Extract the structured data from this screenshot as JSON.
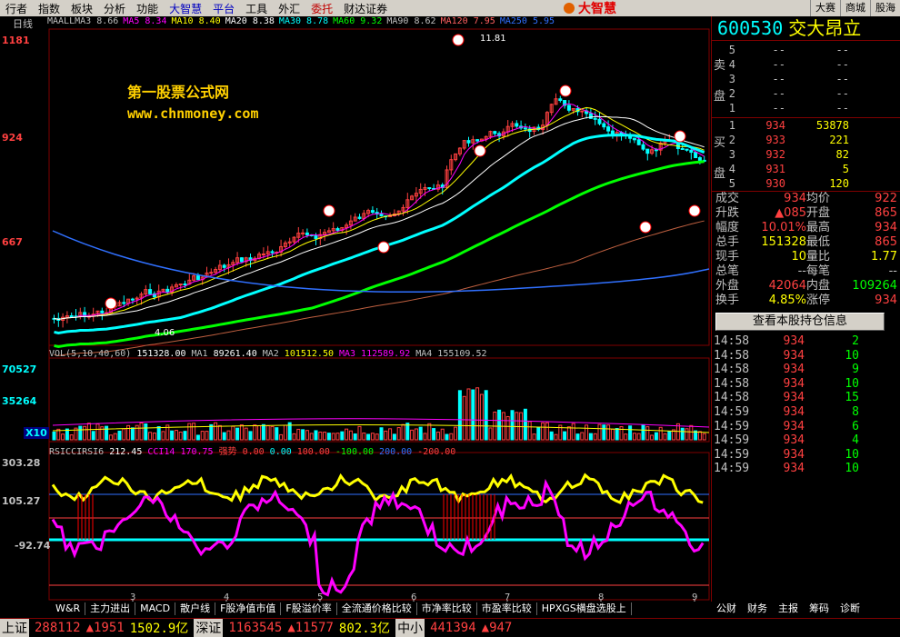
{
  "menu": [
    "行者",
    "指数",
    "板块",
    "分析",
    "功能",
    "大智慧",
    "平台",
    "工具",
    "外汇",
    "委托",
    "财达证券"
  ],
  "logo_text": "大智慧",
  "right_buttons": [
    "大赛",
    "商城",
    "股海"
  ],
  "chart_period": "日线",
  "ma_line": [
    {
      "label": "MAALLMA3",
      "val": "8.66",
      "color": "#c0c0c0"
    },
    {
      "label": "MA5",
      "val": "8.34",
      "color": "#ff00ff"
    },
    {
      "label": "MA10",
      "val": "8.40",
      "color": "#ffff00"
    },
    {
      "label": "MA20",
      "val": "8.38",
      "color": "#ffffff"
    },
    {
      "label": "MA30",
      "val": "8.78",
      "color": "#00ffff"
    },
    {
      "label": "MA60",
      "val": "9.32",
      "color": "#00ff00"
    },
    {
      "label": "MA90",
      "val": "8.62",
      "color": "#c0c0c0"
    },
    {
      "label": "MA120",
      "val": "7.95",
      "color": "#ff6060"
    },
    {
      "label": "MA250",
      "val": "5.95",
      "color": "#3070ff"
    }
  ],
  "price_ticks": [
    "1181",
    "924",
    "667"
  ],
  "high_label": "11.81",
  "low_label": "4.06",
  "watermark": {
    "line1": "第一股票公式网",
    "line2": "www.chnmoney.com"
  },
  "vol_header": [
    {
      "t": "VOL(5,10,40,60)",
      "c": "#c0c0c0"
    },
    {
      "t": "151328.00",
      "c": "#ffffff"
    },
    {
      "t": "MA1",
      "c": "#c0c0c0"
    },
    {
      "t": "89261.40",
      "c": "#ffffff"
    },
    {
      "t": "MA2",
      "c": "#c0c0c0"
    },
    {
      "t": "101512.50",
      "c": "#ffff00"
    },
    {
      "t": "MA3",
      "c": "#ff00ff"
    },
    {
      "t": "112589.92",
      "c": "#ff00ff"
    },
    {
      "t": "MA4",
      "c": "#c0c0c0"
    },
    {
      "t": "155109.52",
      "c": "#c0c0c0"
    }
  ],
  "vol_ticks": [
    "70527",
    "35264",
    "X10"
  ],
  "ind_header": [
    {
      "t": "RSICCIRSI6",
      "c": "#c0c0c0"
    },
    {
      "t": "212.45",
      "c": "#ffffff"
    },
    {
      "t": "CCI14",
      "c": "#ff00ff"
    },
    {
      "t": "170.75",
      "c": "#ff00ff"
    },
    {
      "t": "强势",
      "c": "#ff4040"
    },
    {
      "t": "0.00",
      "c": "#ff4040"
    },
    {
      "t": "0.00",
      "c": "#00ffff"
    },
    {
      "t": "100.00",
      "c": "#ff4040"
    },
    {
      "t": "-100.00",
      "c": "#00ff00"
    },
    {
      "t": "200.00",
      "c": "#3070ff"
    },
    {
      "t": "-200.00",
      "c": "#ff4040"
    }
  ],
  "ind_ticks": [
    "303.28",
    "105.27",
    "-92.74"
  ],
  "month_ticks": [
    "3",
    "4",
    "5",
    "6",
    "7",
    "8",
    "9"
  ],
  "stock": {
    "code": "600530",
    "name": "交大昂立"
  },
  "sell_label": [
    "卖",
    "盘"
  ],
  "buy_label": [
    "买",
    "盘"
  ],
  "asks": [
    {
      "lv": "5",
      "p": "--",
      "v": "--"
    },
    {
      "lv": "4",
      "p": "--",
      "v": "--"
    },
    {
      "lv": "3",
      "p": "--",
      "v": "--"
    },
    {
      "lv": "2",
      "p": "--",
      "v": "--"
    },
    {
      "lv": "1",
      "p": "--",
      "v": "--"
    }
  ],
  "bids": [
    {
      "lv": "1",
      "p": "934",
      "v": "53878"
    },
    {
      "lv": "2",
      "p": "933",
      "v": "221"
    },
    {
      "lv": "3",
      "p": "932",
      "v": "82"
    },
    {
      "lv": "4",
      "p": "931",
      "v": "5"
    },
    {
      "lv": "5",
      "p": "930",
      "v": "120"
    }
  ],
  "quote": [
    {
      "k": "成交",
      "v1": "934",
      "c1": "#ff4040",
      "k2": "均价",
      "v2": "922",
      "c2": "#ff4040"
    },
    {
      "k": "升跌",
      "v1": "▲085",
      "c1": "#ff4040",
      "k2": "开盘",
      "v2": "865",
      "c2": "#ff4040"
    },
    {
      "k": "幅度",
      "v1": "10.01%",
      "c1": "#ff4040",
      "k2": "最高",
      "v2": "934",
      "c2": "#ff4040"
    },
    {
      "k": "总手",
      "v1": "151328",
      "c1": "#ffff00",
      "k2": "最低",
      "v2": "865",
      "c2": "#ff4040"
    },
    {
      "k": "现手",
      "v1": "10",
      "c1": "#ffff00",
      "k2": "量比",
      "v2": "1.77",
      "c2": "#ffff00"
    },
    {
      "k": "总笔",
      "v1": "--",
      "c1": "#c0c0c0",
      "k2": "每笔",
      "v2": "--",
      "c2": "#c0c0c0"
    },
    {
      "k": "外盘",
      "v1": "42064",
      "c1": "#ff4040",
      "k2": "内盘",
      "v2": "109264",
      "c2": "#00ff00"
    },
    {
      "k": "换手",
      "v1": "4.85%",
      "c1": "#ffff00",
      "k2": "涨停",
      "v2": "934",
      "c2": "#ff4040"
    }
  ],
  "position_button": "查看本股持仓信息",
  "ticks": [
    {
      "t": "14:58",
      "p": "934",
      "v": "2"
    },
    {
      "t": "14:58",
      "p": "934",
      "v": "10"
    },
    {
      "t": "14:58",
      "p": "934",
      "v": "9"
    },
    {
      "t": "14:58",
      "p": "934",
      "v": "10"
    },
    {
      "t": "14:58",
      "p": "934",
      "v": "15"
    },
    {
      "t": "14:59",
      "p": "934",
      "v": "8"
    },
    {
      "t": "14:59",
      "p": "934",
      "v": "6"
    },
    {
      "t": "14:59",
      "p": "934",
      "v": "4"
    },
    {
      "t": "14:59",
      "p": "934",
      "v": "10"
    },
    {
      "t": "14:59",
      "p": "934",
      "v": "10"
    }
  ],
  "bottom_tabs": [
    "W&R",
    "主力进出",
    "MACD",
    "散户线",
    "F股净值市值",
    "F股溢价率",
    "全流通价格比较",
    "市净率比较",
    "市盈率比较",
    "HPXGS横盘选股上"
  ],
  "right_tabs": [
    "公财",
    "财务",
    "主报",
    "筹码",
    "诊断"
  ],
  "status": [
    {
      "t": "上证",
      "c": "#000",
      "box": true
    },
    {
      "t": "288112",
      "c": "#ff4040"
    },
    {
      "t": "▲1951",
      "c": "#ff4040"
    },
    {
      "t": "1502.9亿",
      "c": "#ffff00"
    },
    {
      "t": "深证",
      "c": "#000",
      "box": true
    },
    {
      "t": "1163545",
      "c": "#ff4040"
    },
    {
      "t": "▲11577",
      "c": "#ff4040"
    },
    {
      "t": "802.3亿",
      "c": "#ffff00"
    },
    {
      "t": "中小",
      "c": "#000",
      "box": true
    },
    {
      "t": "441394",
      "c": "#ff4040"
    },
    {
      "t": "▲947",
      "c": "#ff4040"
    }
  ]
}
